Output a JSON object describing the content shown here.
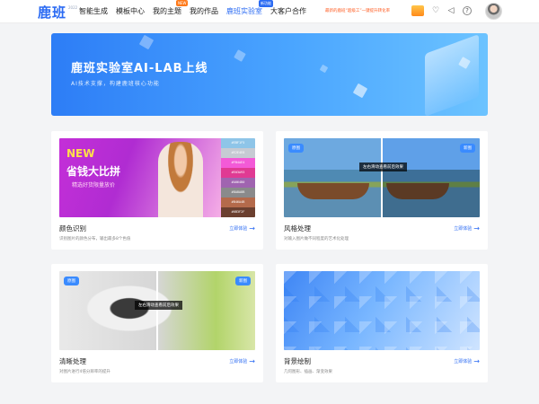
{
  "header": {
    "logo": "鹿班",
    "logo_sup": "2022",
    "nav": [
      {
        "label": "智能生成",
        "badge": ""
      },
      {
        "label": "模板中心",
        "badge": ""
      },
      {
        "label": "我的主题",
        "badge": "NEW"
      },
      {
        "label": "我的作品",
        "badge": ""
      },
      {
        "label": "鹿班实验室",
        "badge": "新功能"
      },
      {
        "label": "大客户合作",
        "badge": ""
      }
    ],
    "promo_text": "最新的鹿班“超级工”一键提升转化率"
  },
  "banner": {
    "title": "鹿班实验室AI-LAB上线",
    "subtitle": "AI技术支撑，构建鹿班核心功能"
  },
  "cards": [
    {
      "title": "颜色识别",
      "desc": "识别图片的颜色分布，输出最多8个色值",
      "link": "立即体验",
      "image": {
        "new": "NEW",
        "headline": "省钱大比拼",
        "sub": "精选好货限量放价",
        "swatches": [
          {
            "hex": "#EBF1F5",
            "color": "#8ec5e8"
          },
          {
            "hex": "#E2E4E8",
            "color": "#c6cbd3"
          },
          {
            "hex": "#FB4AE4",
            "color": "#f35ad7"
          },
          {
            "hex": "#E03A93",
            "color": "#e03a93"
          },
          {
            "hex": "#A064B0",
            "color": "#a064b0"
          },
          {
            "hex": "#8A8A8B",
            "color": "#8a8a8b"
          },
          {
            "hex": "#B46A4B",
            "color": "#b46a4b"
          },
          {
            "hex": "#6B3F2F",
            "color": "#6b3f2f"
          }
        ]
      }
    },
    {
      "title": "风格处理",
      "desc": "对输入图片做不同程度的艺术化处理",
      "link": "立即体验",
      "tag_left": "原图",
      "tag_right": "新图",
      "tip": "左右滑动查看前后效果"
    },
    {
      "title": "清晰处理",
      "desc": "对图片进行4倍分辨率的提升",
      "link": "立即体验",
      "tag_left": "原图",
      "tag_right": "新图",
      "tip": "左右滑动查看前后效果"
    },
    {
      "title": "背景绘制",
      "desc": "几何图形、插画、渐变效果",
      "link": "立即体验"
    }
  ]
}
